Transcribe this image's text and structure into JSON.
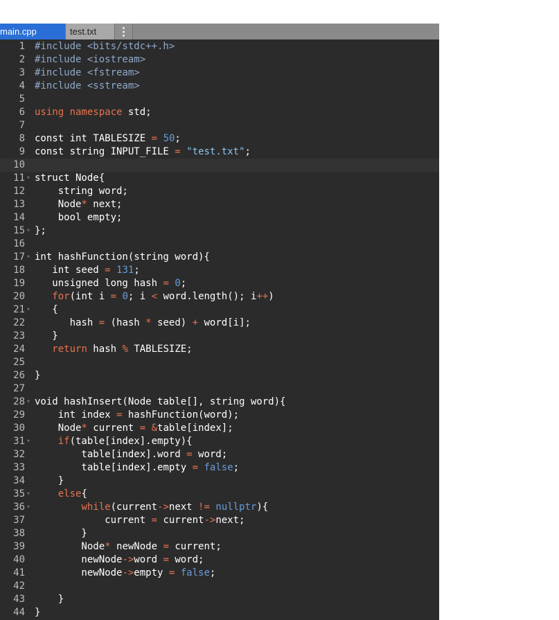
{
  "tabs": [
    {
      "label": "main.cpp",
      "active": true
    },
    {
      "label": "test.txt",
      "active": false
    }
  ],
  "menu_glyph": "⋮",
  "current_line": 10,
  "colors": {
    "background": "#2b2b2b",
    "tab_active": "#2a6fd6",
    "keyword": "#e8734f",
    "number": "#6a9bd8",
    "string": "#8cc4e8",
    "gutter_text": "#bdbdbd"
  },
  "lines": [
    {
      "n": "1",
      "fold": false,
      "t": [
        [
          "inc",
          "#include "
        ],
        [
          "inc",
          "<bits/stdc++.h>"
        ]
      ]
    },
    {
      "n": "2",
      "fold": false,
      "t": [
        [
          "inc",
          "#include "
        ],
        [
          "inc",
          "<iostream>"
        ]
      ]
    },
    {
      "n": "3",
      "fold": false,
      "t": [
        [
          "inc",
          "#include "
        ],
        [
          "inc",
          "<fstream>"
        ]
      ]
    },
    {
      "n": "4",
      "fold": false,
      "t": [
        [
          "inc",
          "#include "
        ],
        [
          "inc",
          "<sstream>"
        ]
      ]
    },
    {
      "n": "5",
      "fold": false,
      "t": []
    },
    {
      "n": "6",
      "fold": false,
      "t": [
        [
          "kw",
          "using namespace "
        ],
        [
          "",
          "std;"
        ]
      ]
    },
    {
      "n": "7",
      "fold": false,
      "t": []
    },
    {
      "n": "8",
      "fold": false,
      "t": [
        [
          "",
          "const int TABLESIZE "
        ],
        [
          "op",
          "="
        ],
        [
          "",
          " "
        ],
        [
          "num",
          "50"
        ],
        [
          "",
          ";"
        ]
      ]
    },
    {
      "n": "9",
      "fold": false,
      "t": [
        [
          "",
          "const string INPUT_FILE "
        ],
        [
          "op",
          "="
        ],
        [
          "",
          " "
        ],
        [
          "str",
          "\"test.txt\""
        ],
        [
          "",
          ";"
        ]
      ]
    },
    {
      "n": "10",
      "fold": false,
      "t": []
    },
    {
      "n": "11",
      "fold": true,
      "t": [
        [
          "",
          "struct Node{"
        ]
      ]
    },
    {
      "n": "12",
      "fold": false,
      "t": [
        [
          "",
          "    string word;"
        ]
      ]
    },
    {
      "n": "13",
      "fold": false,
      "t": [
        [
          "",
          "    Node"
        ],
        [
          "op",
          "*"
        ],
        [
          "",
          " next;"
        ]
      ]
    },
    {
      "n": "14",
      "fold": false,
      "t": [
        [
          "",
          "    bool empty;"
        ]
      ]
    },
    {
      "n": "15",
      "fold": true,
      "t": [
        [
          "",
          "};"
        ]
      ]
    },
    {
      "n": "16",
      "fold": false,
      "t": []
    },
    {
      "n": "17",
      "fold": true,
      "t": [
        [
          "",
          "int hashFunction(string word){"
        ]
      ]
    },
    {
      "n": "18",
      "fold": false,
      "t": [
        [
          "",
          "   int seed "
        ],
        [
          "op",
          "="
        ],
        [
          "",
          " "
        ],
        [
          "num",
          "131"
        ],
        [
          "",
          ";"
        ]
      ]
    },
    {
      "n": "19",
      "fold": false,
      "t": [
        [
          "",
          "   unsigned long hash "
        ],
        [
          "op",
          "="
        ],
        [
          "",
          " "
        ],
        [
          "num",
          "0"
        ],
        [
          "",
          ";"
        ]
      ]
    },
    {
      "n": "20",
      "fold": false,
      "t": [
        [
          "",
          "   "
        ],
        [
          "kw",
          "for"
        ],
        [
          "",
          "(int i "
        ],
        [
          "op",
          "="
        ],
        [
          "",
          " "
        ],
        [
          "num",
          "0"
        ],
        [
          "",
          "; i "
        ],
        [
          "op",
          "<"
        ],
        [
          "",
          " word.length(); i"
        ],
        [
          "op",
          "++"
        ],
        [
          "",
          ")"
        ]
      ]
    },
    {
      "n": "21",
      "fold": true,
      "t": [
        [
          "",
          "   {"
        ]
      ]
    },
    {
      "n": "22",
      "fold": false,
      "t": [
        [
          "",
          "      hash "
        ],
        [
          "op",
          "="
        ],
        [
          "",
          " (hash "
        ],
        [
          "op",
          "*"
        ],
        [
          "",
          " seed) "
        ],
        [
          "op",
          "+"
        ],
        [
          "",
          " word[i];"
        ]
      ]
    },
    {
      "n": "23",
      "fold": false,
      "t": [
        [
          "",
          "   }"
        ]
      ]
    },
    {
      "n": "24",
      "fold": false,
      "t": [
        [
          "",
          "   "
        ],
        [
          "kw",
          "return"
        ],
        [
          "",
          " hash "
        ],
        [
          "op",
          "%"
        ],
        [
          "",
          " TABLESIZE;"
        ]
      ]
    },
    {
      "n": "25",
      "fold": false,
      "t": []
    },
    {
      "n": "26",
      "fold": false,
      "t": [
        [
          "",
          "}"
        ]
      ]
    },
    {
      "n": "27",
      "fold": false,
      "t": []
    },
    {
      "n": "28",
      "fold": true,
      "t": [
        [
          "",
          "void hashInsert(Node table[], string word){"
        ]
      ]
    },
    {
      "n": "29",
      "fold": false,
      "t": [
        [
          "",
          "    int index "
        ],
        [
          "op",
          "="
        ],
        [
          "",
          " hashFunction(word);"
        ]
      ]
    },
    {
      "n": "30",
      "fold": false,
      "t": [
        [
          "",
          "    Node"
        ],
        [
          "op",
          "*"
        ],
        [
          "",
          " current "
        ],
        [
          "op",
          "="
        ],
        [
          "",
          " "
        ],
        [
          "op",
          "&"
        ],
        [
          "",
          "table[index];"
        ]
      ]
    },
    {
      "n": "31",
      "fold": true,
      "t": [
        [
          "",
          "    "
        ],
        [
          "kw",
          "if"
        ],
        [
          "",
          "(table[index].empty){"
        ]
      ]
    },
    {
      "n": "32",
      "fold": false,
      "t": [
        [
          "",
          "        table[index].word "
        ],
        [
          "op",
          "="
        ],
        [
          "",
          " word;"
        ]
      ]
    },
    {
      "n": "33",
      "fold": false,
      "t": [
        [
          "",
          "        table[index].empty "
        ],
        [
          "op",
          "="
        ],
        [
          "",
          " "
        ],
        [
          "num",
          "false"
        ],
        [
          "",
          ";"
        ]
      ]
    },
    {
      "n": "34",
      "fold": false,
      "t": [
        [
          "",
          "    }"
        ]
      ]
    },
    {
      "n": "35",
      "fold": true,
      "t": [
        [
          "",
          "    "
        ],
        [
          "kw",
          "else"
        ],
        [
          "",
          "{"
        ]
      ]
    },
    {
      "n": "36",
      "fold": true,
      "t": [
        [
          "",
          "        "
        ],
        [
          "kw",
          "while"
        ],
        [
          "",
          "(current"
        ],
        [
          "op",
          "->"
        ],
        [
          "",
          "next "
        ],
        [
          "op",
          "!="
        ],
        [
          "",
          " "
        ],
        [
          "num",
          "nullptr"
        ],
        [
          "",
          "){"
        ]
      ]
    },
    {
      "n": "37",
      "fold": false,
      "t": [
        [
          "",
          "            current "
        ],
        [
          "op",
          "="
        ],
        [
          "",
          " current"
        ],
        [
          "op",
          "->"
        ],
        [
          "",
          "next;"
        ]
      ]
    },
    {
      "n": "38",
      "fold": false,
      "t": [
        [
          "",
          "        }"
        ]
      ]
    },
    {
      "n": "39",
      "fold": false,
      "t": [
        [
          "",
          "        Node"
        ],
        [
          "op",
          "*"
        ],
        [
          "",
          " newNode "
        ],
        [
          "op",
          "="
        ],
        [
          "",
          " current;"
        ]
      ]
    },
    {
      "n": "40",
      "fold": false,
      "t": [
        [
          "",
          "        newNode"
        ],
        [
          "op",
          "->"
        ],
        [
          "",
          "word "
        ],
        [
          "op",
          "="
        ],
        [
          "",
          " word;"
        ]
      ]
    },
    {
      "n": "41",
      "fold": false,
      "t": [
        [
          "",
          "        newNode"
        ],
        [
          "op",
          "->"
        ],
        [
          "",
          "empty "
        ],
        [
          "op",
          "="
        ],
        [
          "",
          " "
        ],
        [
          "num",
          "false"
        ],
        [
          "",
          ";"
        ]
      ]
    },
    {
      "n": "42",
      "fold": false,
      "t": []
    },
    {
      "n": "43",
      "fold": false,
      "t": [
        [
          "",
          "    }"
        ]
      ]
    },
    {
      "n": "44",
      "fold": false,
      "t": [
        [
          "",
          "}"
        ]
      ]
    }
  ]
}
